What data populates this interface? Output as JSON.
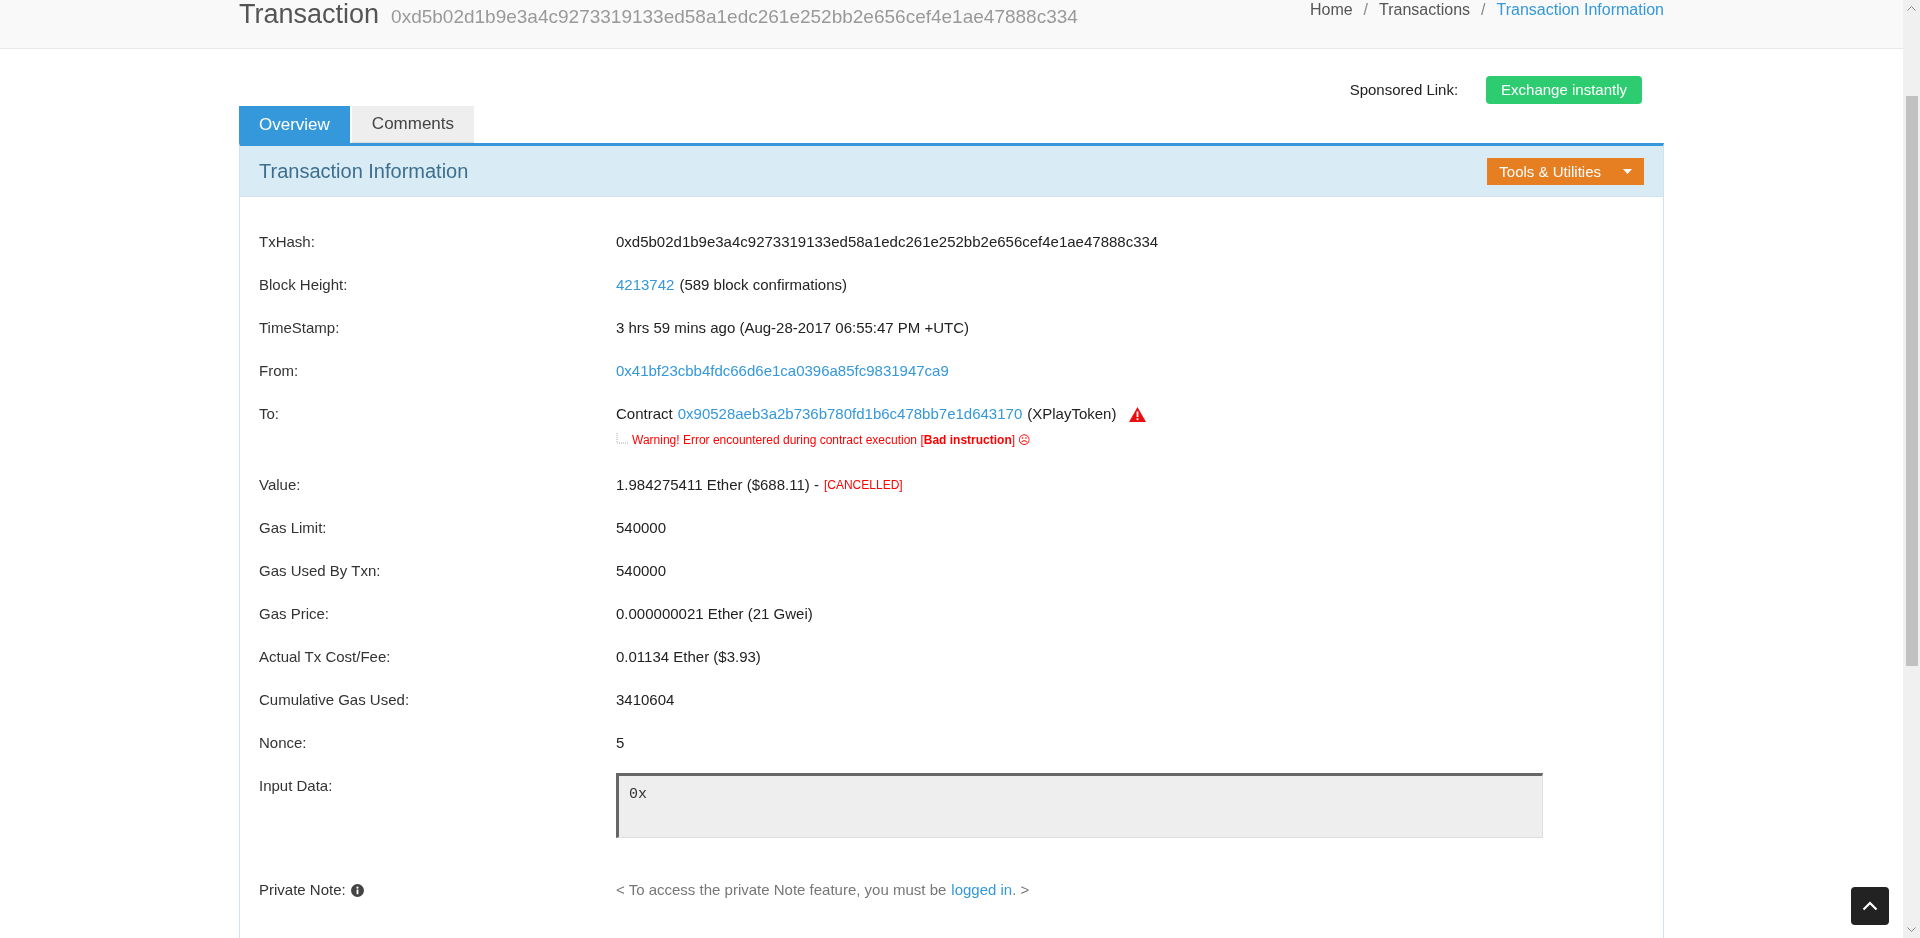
{
  "header": {
    "title": "Transaction",
    "hash": "0xd5b02d1b9e3a4c9273319133ed58a1edc261e252bb2e656cef4e1ae47888c334",
    "breadcrumbs": [
      {
        "label": "Home",
        "selected": false
      },
      {
        "label": "Transactions",
        "selected": false
      },
      {
        "label": "Transaction Information",
        "selected": true
      }
    ],
    "separator": "/"
  },
  "sponsored": {
    "label": "Sponsored Link:",
    "button": "Exchange instantly"
  },
  "tabs": [
    {
      "label": "Overview",
      "selected": true
    },
    {
      "label": "Comments",
      "selected": false
    }
  ],
  "panel": {
    "title": "Transaction Information",
    "tools_button": "Tools & Utilities"
  },
  "rows": [
    {
      "label": "TxHash:",
      "parts": [
        {
          "kind": "text",
          "text": "0xd5b02d1b9e3a4c9273319133ed58a1edc261e252bb2e656cef4e1ae47888c334"
        }
      ]
    },
    {
      "label": "Block Height:",
      "parts": [
        {
          "kind": "link",
          "text": "4213742"
        },
        {
          "kind": "text",
          "text": "(589 block confirmations)"
        }
      ]
    },
    {
      "label": "TimeStamp:",
      "parts": [
        {
          "kind": "text",
          "text": "3 hrs 59 mins ago (Aug-28-2017 06:55:47 PM +UTC)"
        }
      ]
    },
    {
      "label": "From:",
      "parts": [
        {
          "kind": "link",
          "text": "0x41bf23cbb4fdc66d6e1ca0396a85fc9831947ca9"
        }
      ]
    },
    {
      "label": "To:",
      "parts": [
        {
          "kind": "text",
          "text": "Contract"
        },
        {
          "kind": "link",
          "text": "0x90528aeb3a2b736b780fd1b6c478bb7e1d643170"
        },
        {
          "kind": "text",
          "text": "(XPlayToken)"
        },
        {
          "kind": "alert-icon"
        }
      ],
      "warning": "Warning! Error encountered during contract execution [**Bad instruction**] ☹"
    },
    {
      "label": "Value:",
      "parts": [
        {
          "kind": "text",
          "text": "1.984275411 Ether ($688.11) -"
        },
        {
          "kind": "status",
          "text": "[CANCELLED]"
        }
      ]
    },
    {
      "label": "Gas Limit:",
      "parts": [
        {
          "kind": "text",
          "text": "540000"
        }
      ]
    },
    {
      "label": "Gas Used By Txn:",
      "parts": [
        {
          "kind": "text",
          "text": "540000"
        }
      ]
    },
    {
      "label": "Gas Price:",
      "parts": [
        {
          "kind": "text",
          "text": "0.000000021 Ether (21 Gwei)"
        }
      ]
    },
    {
      "label": "Actual Tx Cost/Fee:",
      "parts": [
        {
          "kind": "text",
          "text": "0.01134 Ether ($3.93)"
        }
      ]
    },
    {
      "label": "Cumulative Gas Used:",
      "parts": [
        {
          "kind": "text",
          "text": "3410604"
        }
      ]
    },
    {
      "label": "Nonce:",
      "parts": [
        {
          "kind": "text",
          "text": "5"
        }
      ]
    },
    {
      "label": "Input Data:",
      "parts": [
        {
          "kind": "code-box",
          "text": "0x"
        }
      ]
    },
    {
      "label": "Private Note:",
      "info_icon": true,
      "parts": [
        {
          "kind": "muted",
          "text": "< To access the private Note feature, you must be"
        },
        {
          "kind": "link-tight",
          "text": "logged in"
        },
        {
          "kind": "muted-tight",
          "text": ". >"
        }
      ]
    }
  ]
}
